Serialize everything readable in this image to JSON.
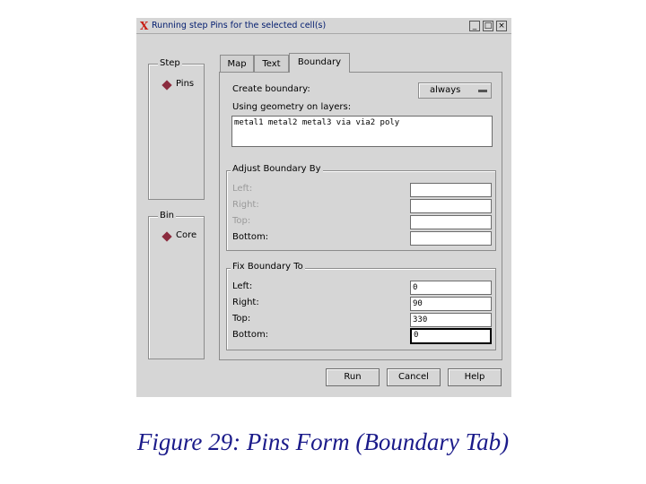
{
  "window": {
    "title": "Running step Pins for the selected cell(s)",
    "buttons": {
      "minimize": "_",
      "maximize": "□",
      "close": "×"
    }
  },
  "step_group": {
    "label": "Step",
    "option": "Pins"
  },
  "bin_group": {
    "label": "Bin",
    "option": "Core"
  },
  "tabs": [
    {
      "label": "Map"
    },
    {
      "label": "Text"
    },
    {
      "label": "Boundary",
      "active": true
    }
  ],
  "boundary": {
    "create_label": "Create boundary:",
    "create_value": "always",
    "geometry_label": "Using geometry on layers:",
    "geometry_value": "metal1 metal2 metal3 via via2 poly"
  },
  "adjust_group": {
    "label": "Adjust Boundary By",
    "left_label": "Left:",
    "right_label": "Right:",
    "top_label": "Top:",
    "bottom_label": "Bottom:",
    "left_value": "",
    "right_value": "",
    "top_value": "",
    "bottom_value": ""
  },
  "fix_group": {
    "label": "Fix Boundary To",
    "left_label": "Left:",
    "right_label": "Right:",
    "top_label": "Top:",
    "bottom_label": "Bottom:",
    "left_value": "0",
    "right_value": "90",
    "top_value": "330",
    "bottom_value": "0"
  },
  "actions": {
    "run": "Run",
    "cancel": "Cancel",
    "help": "Help"
  },
  "caption": "Figure 29: Pins Form (Boundary Tab)",
  "colors": {
    "title_text": "#001b6e",
    "radio": "#8b2b3e",
    "caption": "#1b1b8a"
  }
}
